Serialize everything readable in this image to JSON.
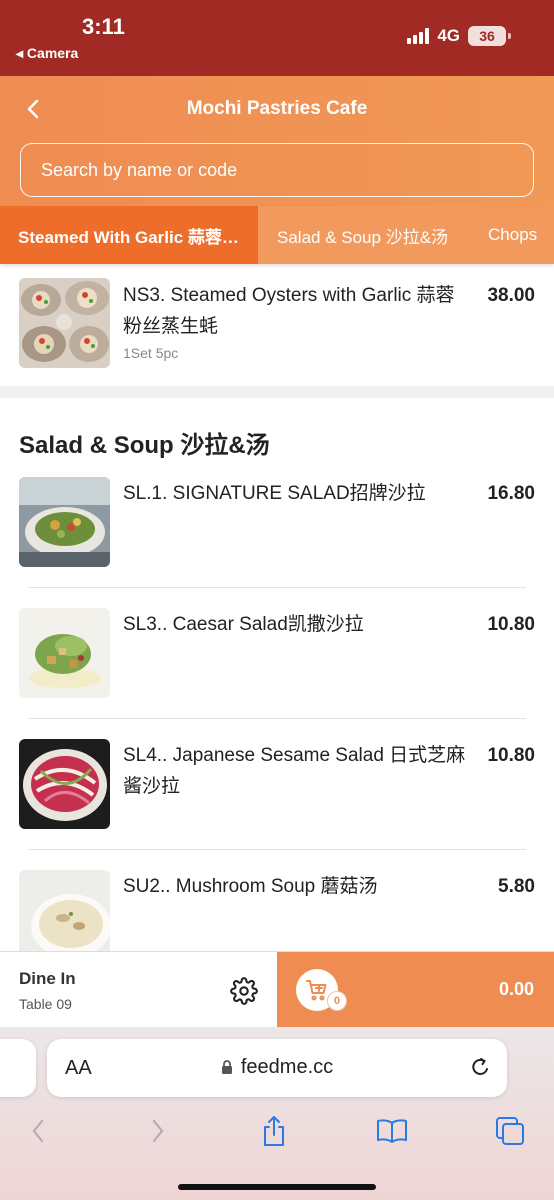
{
  "status": {
    "time": "3:11",
    "back_app": "◂ Camera",
    "network": "4G",
    "battery": "36"
  },
  "header": {
    "title": "Mochi Pastries Cafe",
    "search_placeholder": "Search by name or code"
  },
  "tabs": [
    {
      "label": "Steamed With Garlic 蒜蓉粉丝蒸",
      "active": true
    },
    {
      "label": "Salad & Soup 沙拉&汤",
      "active": false
    },
    {
      "label": "Chops",
      "active": false
    }
  ],
  "menu": {
    "top_item": {
      "name": "NS3. Steamed Oysters with Garlic 蒜蓉粉丝蒸生蚝",
      "price": "38.00",
      "sub": "1Set 5pc"
    },
    "section_title": "Salad & Soup 沙拉&汤",
    "items": [
      {
        "name": "SL.1. SIGNATURE SALAD招牌沙拉",
        "price": "16.80"
      },
      {
        "name": "SL3.. Caesar Salad凯撒沙拉",
        "price": "10.80"
      },
      {
        "name": "SL4.. Japanese Sesame Salad 日式芝麻酱沙拉",
        "price": "10.80"
      },
      {
        "name": "SU2.. Mushroom Soup 蘑菇汤",
        "price": "5.80"
      }
    ]
  },
  "order_bar": {
    "mode": "Dine In",
    "table": "Table 09",
    "cart_count": "0",
    "total": "0.00"
  },
  "browser": {
    "text_size_label": "AA",
    "url": "feedme.cc"
  },
  "colors": {
    "status_bar": "#a12a24",
    "accent": "#ef8c52",
    "active_tab": "#ee6d2a"
  }
}
